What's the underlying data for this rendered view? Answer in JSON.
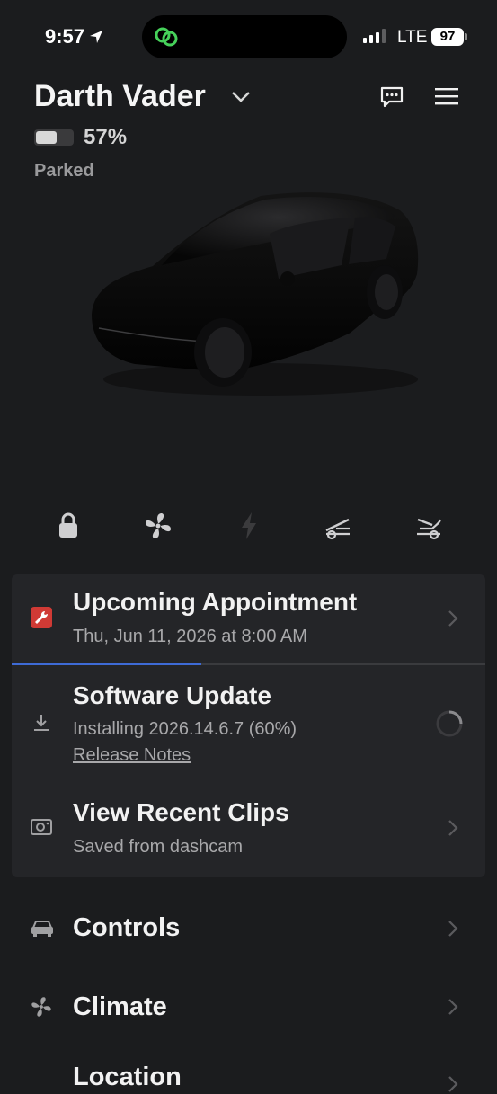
{
  "status_bar": {
    "time": "9:57",
    "network": "LTE",
    "battery": "97",
    "signal_bars_active": 3,
    "signal_bars_total": 4
  },
  "header": {
    "car_name": "Darth Vader",
    "battery_percent": "57%",
    "battery_level": 0.57,
    "state": "Parked"
  },
  "quick_controls": [
    {
      "icon": "lock-icon"
    },
    {
      "icon": "fan-icon"
    },
    {
      "icon": "charge-bolt-icon"
    },
    {
      "icon": "frunk-icon"
    },
    {
      "icon": "trunk-icon"
    }
  ],
  "appointment": {
    "title": "Upcoming Appointment",
    "subtitle": "Thu, Jun 11, 2026 at 8:00 AM",
    "icon": "wrench-icon",
    "icon_color": "#d03a35"
  },
  "software_update": {
    "title": "Software Update",
    "subtitle": "Installing 2026.14.6.7 (60%)",
    "progress": 0.4,
    "link": "Release Notes",
    "accent": "#3e6bd6"
  },
  "recent_clips": {
    "title": "View Recent Clips",
    "subtitle": "Saved from dashcam"
  },
  "menu": [
    {
      "label": "Controls",
      "icon": "car-icon"
    },
    {
      "label": "Climate",
      "icon": "fan-icon"
    },
    {
      "label": "Location",
      "icon": "location-icon"
    }
  ]
}
